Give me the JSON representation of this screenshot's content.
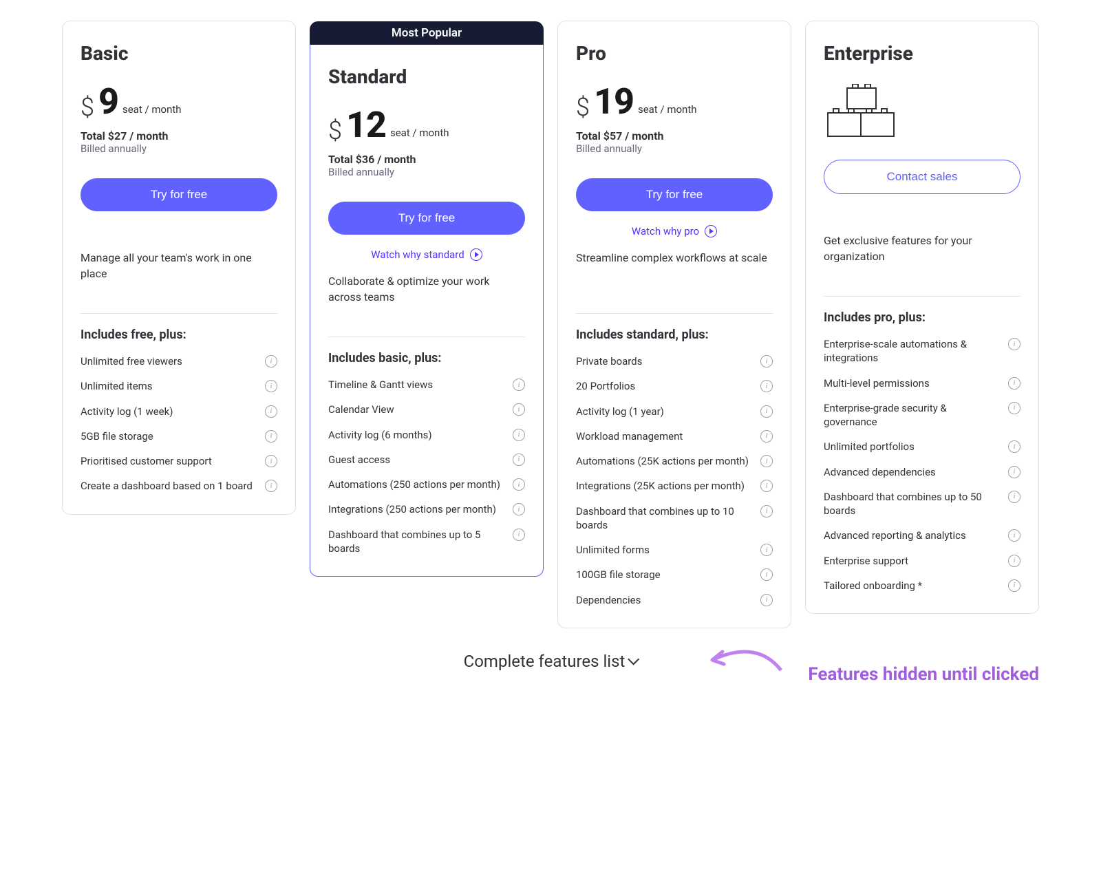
{
  "popular_badge": "Most Popular",
  "currency": "$",
  "billed_annually": "Billed annually",
  "try_for_free": "Try for free",
  "contact_sales": "Contact sales",
  "info_glyph": "i",
  "complete_features": "Complete features list",
  "annotation": "Features hidden until clicked",
  "plans": [
    {
      "name": "Basic",
      "price": "9",
      "unit": "seat / month",
      "total": "Total $27 / month",
      "watch": "",
      "description": "Manage all your team's work in one place",
      "includes_heading": "Includes free, plus:",
      "features": [
        "Unlimited free viewers",
        "Unlimited items",
        "Activity log (1 week)",
        "5GB file storage",
        "Prioritised customer support",
        "Create a dashboard based on 1 board"
      ]
    },
    {
      "name": "Standard",
      "price": "12",
      "unit": "seat / month",
      "total": "Total $36 / month",
      "watch": "Watch why standard",
      "description": "Collaborate & optimize your work across teams",
      "includes_heading": "Includes basic, plus:",
      "features": [
        "Timeline & Gantt views",
        "Calendar View",
        "Activity log (6 months)",
        "Guest access",
        "Automations (250 actions per month)",
        "Integrations (250 actions per month)",
        "Dashboard that  combines up to 5 boards"
      ]
    },
    {
      "name": "Pro",
      "price": "19",
      "unit": "seat / month",
      "total": "Total $57 / month",
      "watch": "Watch why pro",
      "description": "Streamline complex workflows at scale",
      "includes_heading": "Includes standard, plus:",
      "features": [
        "Private boards",
        "20 Portfolios",
        "Activity log (1 year)",
        "Workload management",
        "Automations (25K actions per month)",
        "Integrations (25K actions per month)",
        "Dashboard that combines up to 10 boards",
        "Unlimited forms",
        "100GB file storage",
        "Dependencies"
      ]
    },
    {
      "name": "Enterprise",
      "price": "",
      "unit": "",
      "total": "",
      "watch": "",
      "description": "Get exclusive features for your organization",
      "includes_heading": "Includes pro, plus:",
      "features": [
        "Enterprise-scale automations & integrations",
        "Multi-level permissions",
        "Enterprise-grade security & governance",
        "Unlimited portfolios",
        "Advanced dependencies",
        "Dashboard that combines up to 50 boards",
        "Advanced reporting & analytics",
        "Enterprise support",
        "Tailored onboarding *"
      ]
    }
  ]
}
